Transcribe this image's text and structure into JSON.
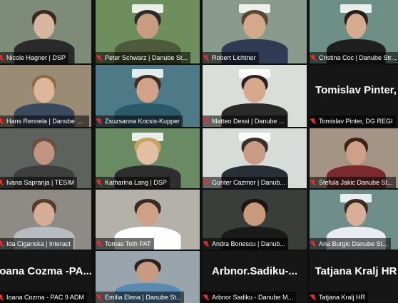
{
  "participants": [
    {
      "name": "Nicole Hagner | DSP",
      "speaking": false,
      "bg": "#7d8b78",
      "skin": "#d8b7a0",
      "hair": "#3a2a20",
      "shirt": "#2a2a2a",
      "logo": false
    },
    {
      "name": "Peter Schwarz | Danube St...",
      "speaking": false,
      "bg": "#6f8e5e",
      "skin": "#c89c82",
      "hair": "#2a2a2a",
      "shirt": "#4d5b3c",
      "logo": true
    },
    {
      "name": "Robert Lichtner",
      "speaking": true,
      "bg": "#8a9a8c",
      "skin": "#d4a88a",
      "hair": "#5a4432",
      "shirt": "#2f3b52",
      "logo": true
    },
    {
      "name": "Cristina Coc | Danube Str...",
      "speaking": false,
      "bg": "#6e8f86",
      "skin": "#d6ac90",
      "hair": "#2a1e18",
      "shirt": "#1f1f1f",
      "logo": true
    },
    {
      "name": "Hans Rennela | Danube St...",
      "speaking": false,
      "bg": "#9a8c74",
      "skin": "#e0b69a",
      "hair": "#8a6c48",
      "shirt": "#3a4a5e",
      "logo": false
    },
    {
      "name": "Zsuzsanna Kocsis-Kupper",
      "speaking": false,
      "bg": "#4d7a86",
      "skin": "#d2a288",
      "hair": "#3b2b22",
      "shirt": "#2a5a6a",
      "logo": true
    },
    {
      "name": "Matteo Dessi | Danube ...",
      "speaking": false,
      "bg": "#d9ded8",
      "skin": "#d6a98c",
      "hair": "#2a2220",
      "shirt": "#2a2a2a",
      "logo": true
    },
    {
      "name": "Tomislav Pinter, DG REGI",
      "speaking": false,
      "bg": "#161616",
      "avatar": "Tomislav Pinter,"
    },
    {
      "name": "Ivana Sapranja | TESIM",
      "speaking": false,
      "bg": "#5e625e",
      "skin": "#c09480",
      "hair": "#6a5040",
      "shirt": "#3e3e3e",
      "logo": false
    },
    {
      "name": "Katharina Lang | DSP",
      "speaking": false,
      "bg": "#6a8a64",
      "skin": "#e2bfa2",
      "hair": "#c8a460",
      "shirt": "#2e2e2e",
      "logo": true
    },
    {
      "name": "Gunter Cazmor | Danub...",
      "speaking": false,
      "bg": "#d7dcd9",
      "skin": "#c89c84",
      "hair": "#3a302a",
      "shirt": "#2a2e36",
      "logo": true
    },
    {
      "name": "Stefula Jakic Danube St...",
      "speaking": false,
      "bg": "#a49484",
      "skin": "#cfa088",
      "hair": "#3a2418",
      "shirt": "#7a2a2a",
      "logo": false
    },
    {
      "name": "Ida Ciganska | Interact",
      "speaking": false,
      "bg": "#8e8a86",
      "skin": "#d6ad96",
      "hair": "#5a3a2a",
      "shirt": "#b8bcc0",
      "logo": false
    },
    {
      "name": "Tomas Toth PAT",
      "speaking": false,
      "bg": "#b4b0aa",
      "skin": "#cea086",
      "hair": "#3a2a22",
      "shirt": "#ffffff",
      "logo": false
    },
    {
      "name": "Andra Bonescu | Danub...",
      "speaking": false,
      "bg": "#3a3e3a",
      "skin": "#c8997e",
      "hair": "#1e1410",
      "shirt": "#1a1a1a",
      "logo": false
    },
    {
      "name": "Ana Burgic Danube St...",
      "speaking": false,
      "bg": "#6f8e8a",
      "skin": "#d8ae96",
      "hair": "#3a2a20",
      "shirt": "#e8ecf0",
      "logo": true
    },
    {
      "name": "Ioana Cozma - PAC 9 ADM",
      "speaking": false,
      "bg": "#161616",
      "avatar": "Ioana Cozma -PA..."
    },
    {
      "name": "Emilia Elena | Danube St...",
      "speaking": false,
      "bg": "#9aa4ac",
      "skin": "#c89a82",
      "hair": "#2a2220",
      "shirt": "#5a8ab0",
      "logo": false
    },
    {
      "name": "Arbnor Sadiku - Danube M...",
      "speaking": false,
      "bg": "#161616",
      "avatar": "Arbnor.Sadiku-..."
    },
    {
      "name": "Tatjana Kralj HR",
      "speaking": false,
      "bg": "#161616",
      "avatar": "Tatjana Kralj HR"
    }
  ]
}
